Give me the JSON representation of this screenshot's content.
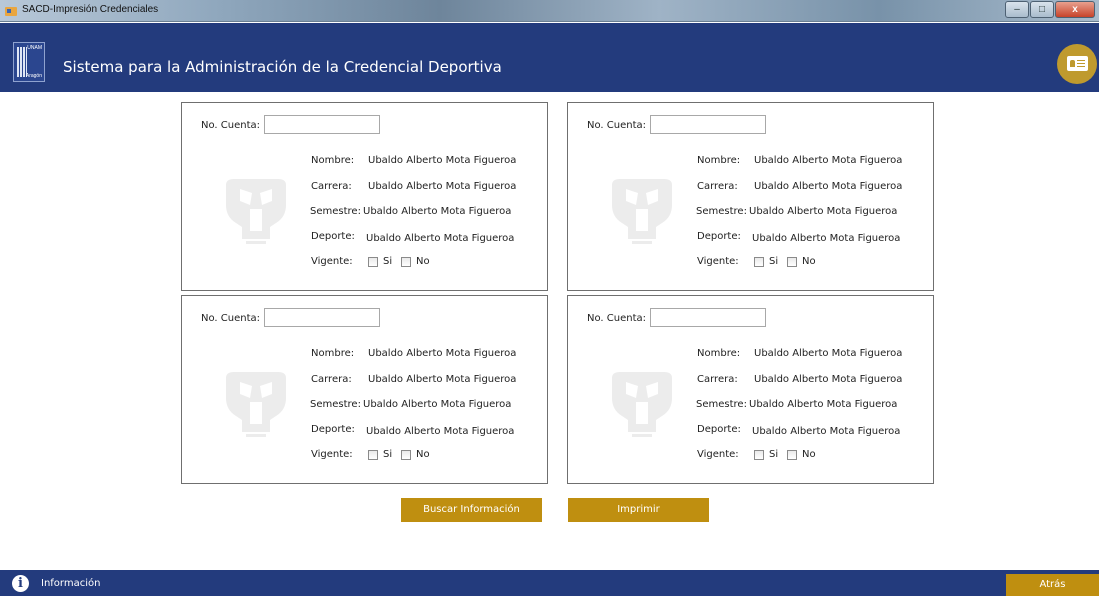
{
  "window": {
    "title": "SACD-Impresión Credenciales",
    "minimize": "–",
    "maximize": "□",
    "close": "x"
  },
  "header": {
    "logo_top": "UNAM",
    "logo_bottom": "Aragón",
    "title": "Sistema para la Administración de la Credencial Deportiva",
    "card_icon": "id-card-icon"
  },
  "panels": [
    {
      "cuenta_label": "No. Cuenta:",
      "cuenta_value": "",
      "nombre_label": "Nombre:",
      "nombre": "Ubaldo Alberto Mota Figueroa",
      "carrera_label": "Carrera:",
      "carrera": "Ubaldo Alberto Mota Figueroa",
      "semestre_label": "Semestre:",
      "semestre": "Ubaldo Alberto Mota Figueroa",
      "deporte_label": "Deporte:",
      "deporte": "Ubaldo Alberto Mota Figueroa",
      "vigente_label": "Vigente:",
      "si_label": "Si",
      "no_label": "No"
    },
    {
      "cuenta_label": "No. Cuenta:",
      "cuenta_value": "",
      "nombre_label": "Nombre:",
      "nombre": "Ubaldo Alberto Mota Figueroa",
      "carrera_label": "Carrera:",
      "carrera": "Ubaldo Alberto Mota Figueroa",
      "semestre_label": "Semestre:",
      "semestre": "Ubaldo Alberto Mota Figueroa",
      "deporte_label": "Deporte:",
      "deporte": "Ubaldo Alberto Mota Figueroa",
      "vigente_label": "Vigente:",
      "si_label": "Si",
      "no_label": "No"
    },
    {
      "cuenta_label": "No. Cuenta:",
      "cuenta_value": "",
      "nombre_label": "Nombre:",
      "nombre": "Ubaldo Alberto Mota Figueroa",
      "carrera_label": "Carrera:",
      "carrera": "Ubaldo Alberto Mota Figueroa",
      "semestre_label": "Semestre:",
      "semestre": "Ubaldo Alberto Mota Figueroa",
      "deporte_label": "Deporte:",
      "deporte": "Ubaldo Alberto Mota Figueroa",
      "vigente_label": "Vigente:",
      "si_label": "Si",
      "no_label": "No"
    },
    {
      "cuenta_label": "No. Cuenta:",
      "cuenta_value": "",
      "nombre_label": "Nombre:",
      "nombre": "Ubaldo Alberto Mota Figueroa",
      "carrera_label": "Carrera:",
      "carrera": "Ubaldo Alberto Mota Figueroa",
      "semestre_label": "Semestre:",
      "semestre": "Ubaldo Alberto Mota Figueroa",
      "deporte_label": "Deporte:",
      "deporte": "Ubaldo Alberto Mota Figueroa",
      "vigente_label": "Vigente:",
      "si_label": "Si",
      "no_label": "No"
    }
  ],
  "actions": {
    "buscar": "Buscar Información",
    "imprimir": "Imprimir"
  },
  "footer": {
    "info_label": "Información",
    "info_icon": "i",
    "atras": "Atrás"
  },
  "colors": {
    "header_blue": "#233b7d",
    "gold": "#bf8f10",
    "card_gold": "#bf9a2e"
  }
}
